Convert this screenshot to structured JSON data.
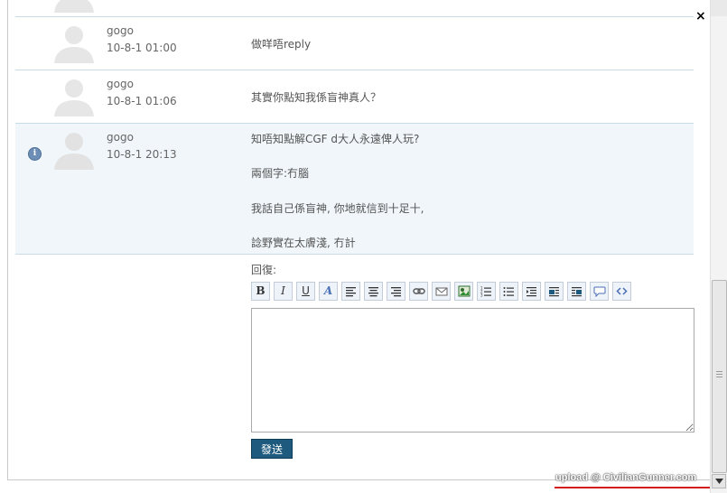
{
  "close_glyph": "×",
  "posts": [
    {
      "author": "gogo",
      "time": "10-8-1 01:00",
      "lines": [
        "做咩唔reply"
      ]
    },
    {
      "author": "gogo",
      "time": "10-8-1 01:06",
      "lines": [
        "其實你點知我係盲神真人？"
      ]
    },
    {
      "author": "gogo",
      "time": "10-8-1 20:13",
      "lines": [
        "知唔知點解CGF d大人永遠俾人玩?",
        "兩個字:冇腦",
        "我話自己係盲神, 你地就信到十足十,",
        "諗野實在太膚淺, 冇計"
      ]
    }
  ],
  "reply": {
    "label": "回復:",
    "send_label": "發送",
    "editor_value": "",
    "toolbar": [
      "bold-icon",
      "italic-icon",
      "underline-icon",
      "font-color-icon",
      "align-left-icon",
      "align-center-icon",
      "align-right-icon",
      "link-icon",
      "email-icon",
      "image-icon",
      "ordered-list-icon",
      "unordered-list-icon",
      "indent-icon",
      "float-left-icon",
      "float-right-icon",
      "quote-icon",
      "code-icon"
    ]
  },
  "watermark": "upload @ CivilianGunner.com",
  "colors": {
    "highlight_row": "#f0f6fa",
    "divider": "#c8dde3",
    "send_button": "#1e5a7e"
  }
}
